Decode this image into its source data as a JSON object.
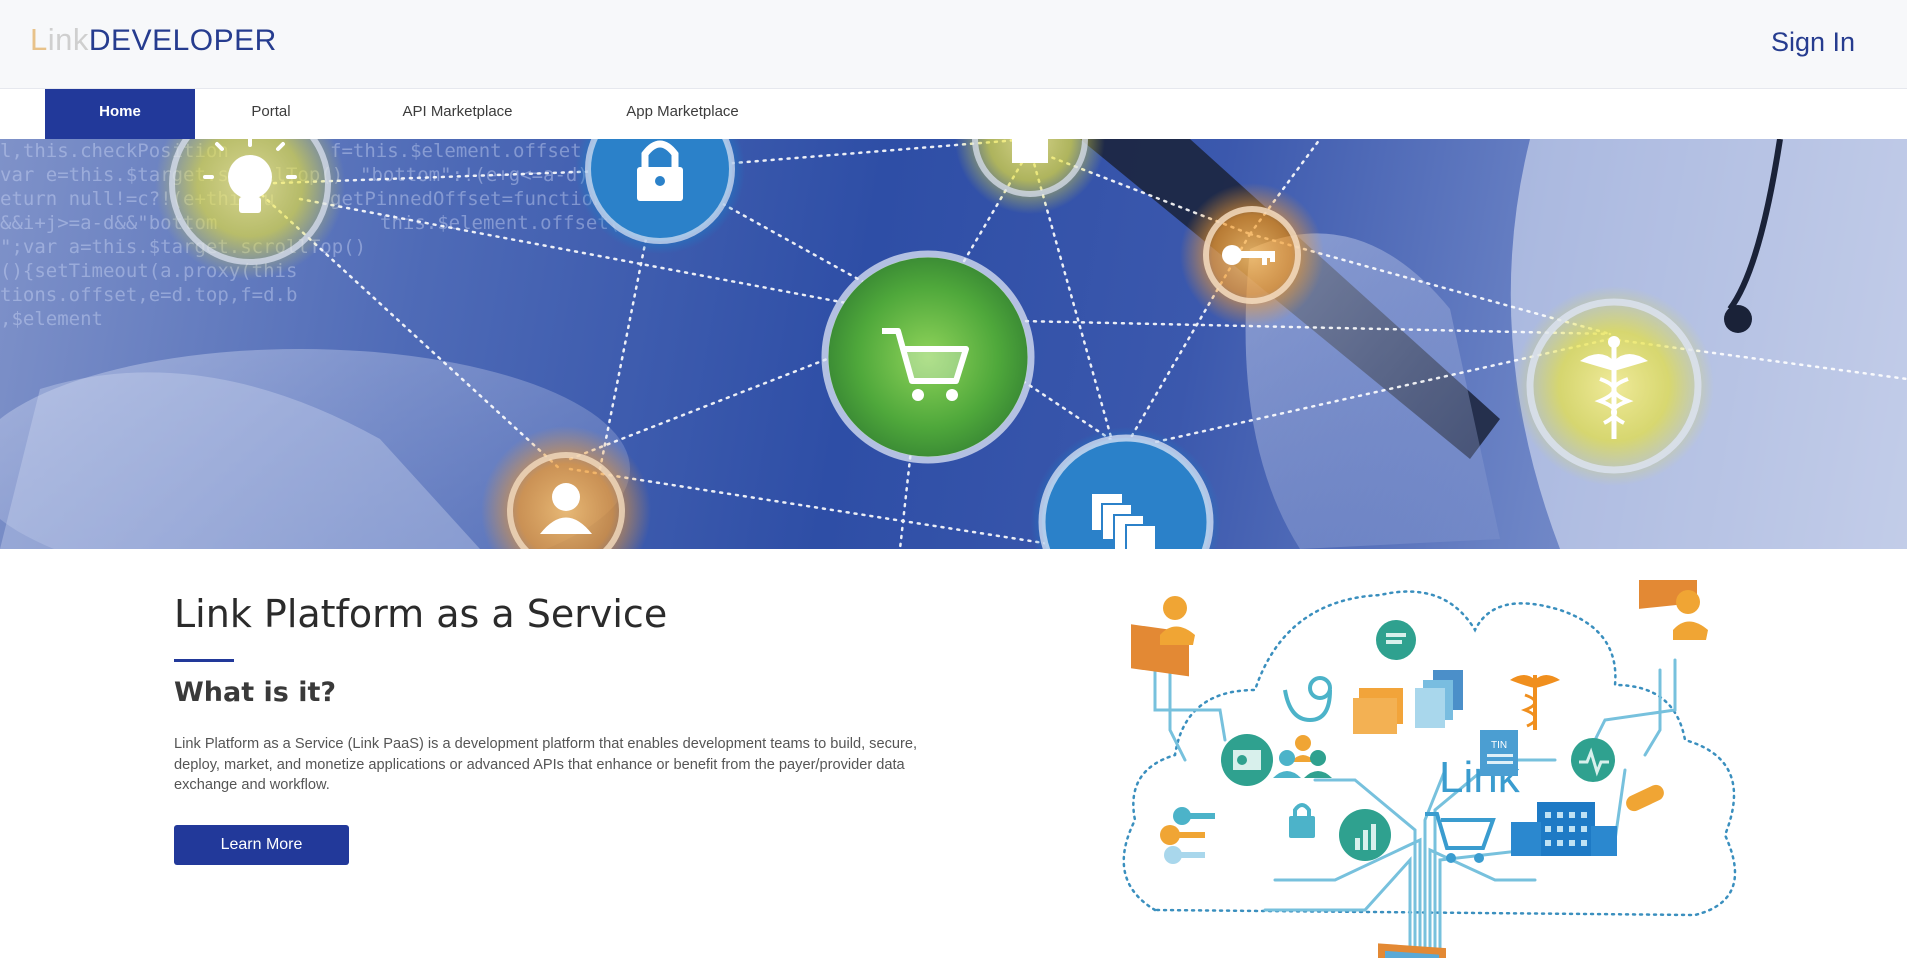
{
  "header": {
    "logo_part1": "L",
    "logo_part2": "ink",
    "logo_part3": "DEVELOPER",
    "sign_in": "Sign In"
  },
  "nav": {
    "tabs": [
      {
        "label": "Home",
        "active": true
      },
      {
        "label": "Portal",
        "active": false
      },
      {
        "label": "API Marketplace",
        "active": false
      },
      {
        "label": "App Marketplace",
        "active": false
      }
    ]
  },
  "hero": {
    "icons": [
      "lightbulb-icon",
      "lock-icon",
      "document-icon",
      "key-icon",
      "shopping-cart-icon",
      "caduceus-icon",
      "user-icon",
      "files-icon"
    ]
  },
  "main": {
    "title": "Link Platform as a Service",
    "subtitle": "What is it?",
    "description": "Link Platform as a Service (Link PaaS) is a development platform that enables development teams to build, secure, deploy, market, and monetize applications or advanced APIs that enhance or benefit from the payer/provider data exchange and workflow.",
    "button_label": "Learn More"
  },
  "illustration": {
    "label": "Link"
  },
  "colors": {
    "brand_blue": "#22399a",
    "accent_orange": "#f0931e",
    "accent_teal": "#4cb3c9"
  }
}
